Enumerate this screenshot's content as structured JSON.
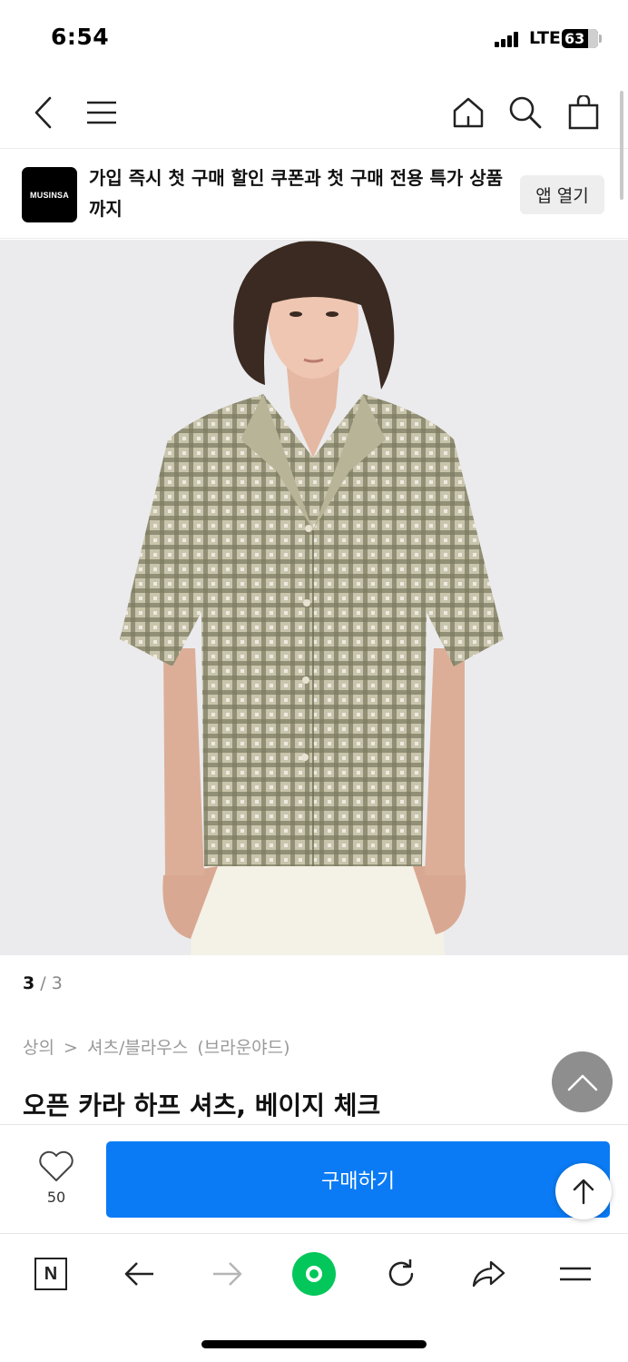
{
  "status_bar": {
    "time": "6:54",
    "network": "LTE",
    "battery": "63"
  },
  "header": {
    "back_icon": "chevron-left-icon",
    "menu_icon": "hamburger-icon",
    "home_icon": "home-icon",
    "search_icon": "search-icon",
    "cart_icon": "shopping-bag-icon"
  },
  "app_banner": {
    "logo_text": "MUSINSA",
    "message": "가입 즉시 첫 구매 할인 쿠폰과 첫 구매 전용 특가 상품 까지",
    "open_app_label": "앱 열기"
  },
  "gallery": {
    "current": "3",
    "separator": "/",
    "total": "3"
  },
  "product": {
    "breadcrumb": [
      "상의",
      ">",
      "셔츠/블라우스",
      "(브라운야드)"
    ],
    "title": "오픈 카라 하프 셔츠, 베이지 체크"
  },
  "purchase_bar": {
    "like_count": "50",
    "buy_label": "구매하기"
  },
  "browser_toolbar": {
    "icons": [
      "naver-n-icon",
      "back-arrow-icon",
      "forward-arrow-icon",
      "green-dot-icon",
      "reload-icon",
      "share-icon",
      "menu-icon"
    ]
  },
  "colors": {
    "accent": "#0a7bf5",
    "naver_green": "#03c75a",
    "image_bg": "#ebebed",
    "shirt": "#8c8a6c"
  }
}
